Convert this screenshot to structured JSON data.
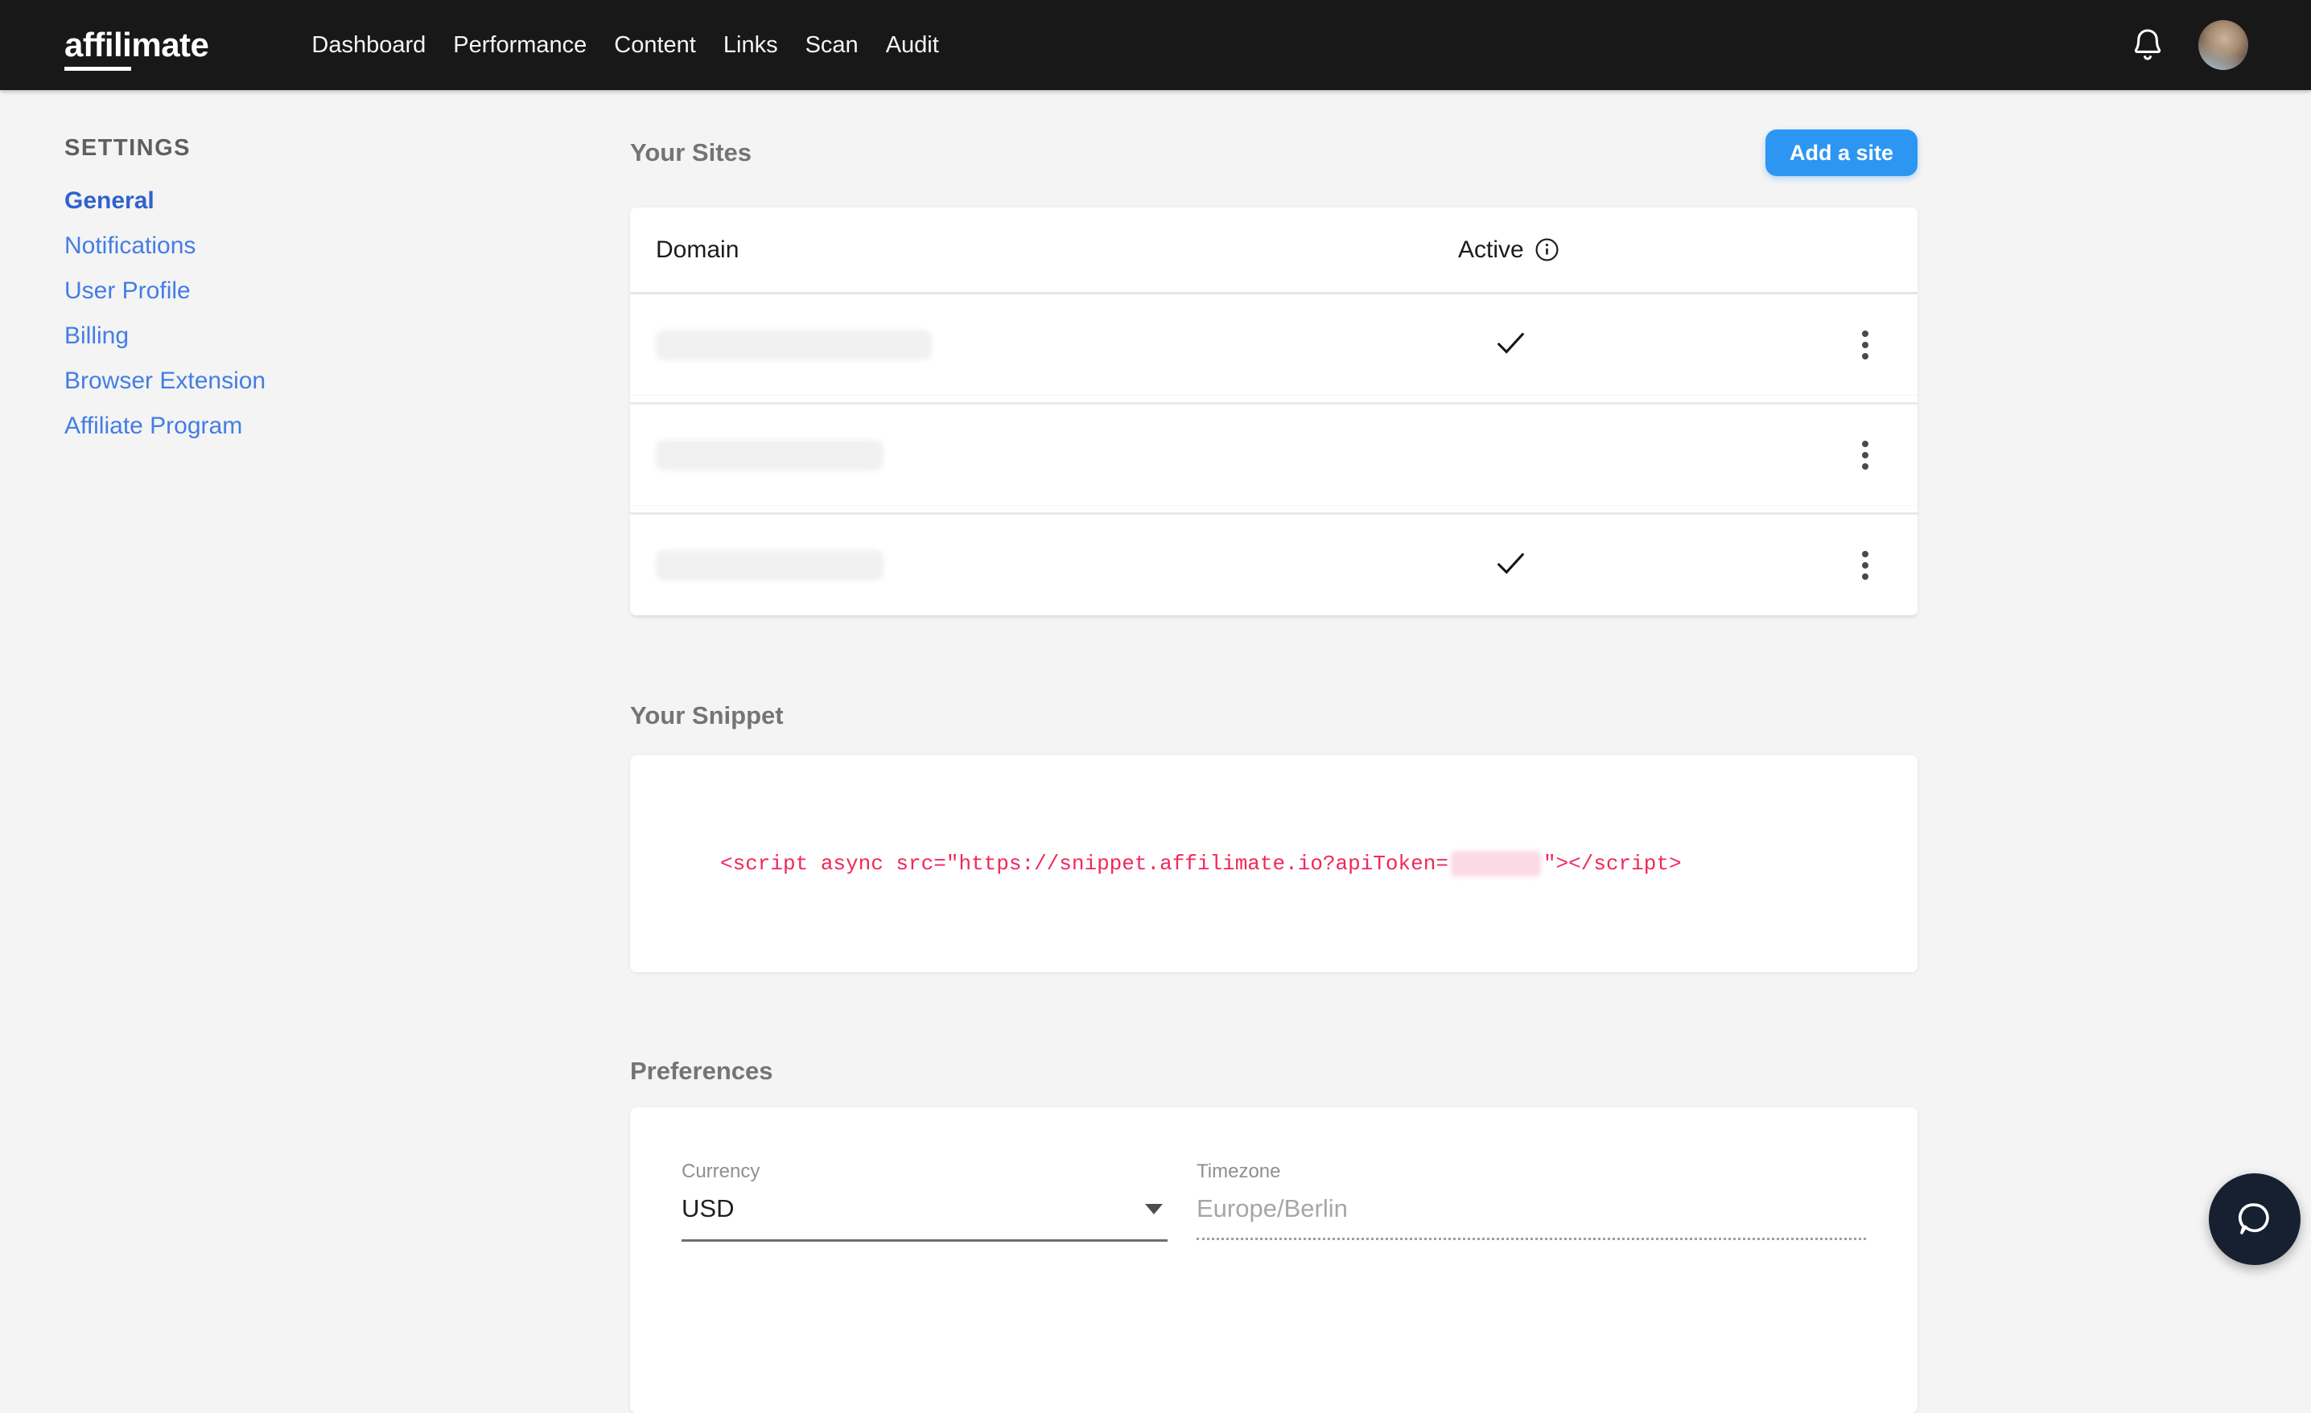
{
  "nav": {
    "logo": {
      "part_underlined": "affili",
      "part_rest": "mate"
    },
    "items": [
      {
        "label": "Dashboard"
      },
      {
        "label": "Performance"
      },
      {
        "label": "Content"
      },
      {
        "label": "Links"
      },
      {
        "label": "Scan"
      },
      {
        "label": "Audit"
      }
    ]
  },
  "sidebar": {
    "heading": "SETTINGS",
    "items": [
      {
        "label": "General",
        "active": true
      },
      {
        "label": "Notifications",
        "active": false
      },
      {
        "label": "User Profile",
        "active": false
      },
      {
        "label": "Billing",
        "active": false
      },
      {
        "label": "Browser Extension",
        "active": false
      },
      {
        "label": "Affiliate Program",
        "active": false
      }
    ]
  },
  "main": {
    "sites": {
      "title": "Your Sites",
      "add_button_label": "Add a site",
      "table": {
        "columns": {
          "domain": "Domain",
          "active": "Active"
        },
        "rows": [
          {
            "domain_redacted": true,
            "pill_width": 343,
            "active": true
          },
          {
            "domain_redacted": true,
            "pill_width": 283,
            "active": false
          },
          {
            "domain_redacted": true,
            "pill_width": 283,
            "active": true
          }
        ]
      }
    },
    "snippet": {
      "title": "Your Snippet",
      "code_before_token": "<script async src=\"https://snippet.affilimate.io?apiToken=",
      "token_redacted": true,
      "code_after_token": "\"></script>"
    },
    "preferences": {
      "title": "Preferences",
      "currency": {
        "label": "Currency",
        "value": "USD"
      },
      "timezone": {
        "label": "Timezone",
        "placeholder": "Europe/Berlin"
      }
    }
  },
  "colors": {
    "topnav_bg": "#181818",
    "accent_button_blue": "#2d96f3",
    "sidebar_link_blue": "#447de4",
    "sidebar_active_blue": "#2f62cf",
    "code_pink": "#f1275b",
    "chat_fab_bg": "#172031",
    "page_bg": "#f4f4f4"
  }
}
